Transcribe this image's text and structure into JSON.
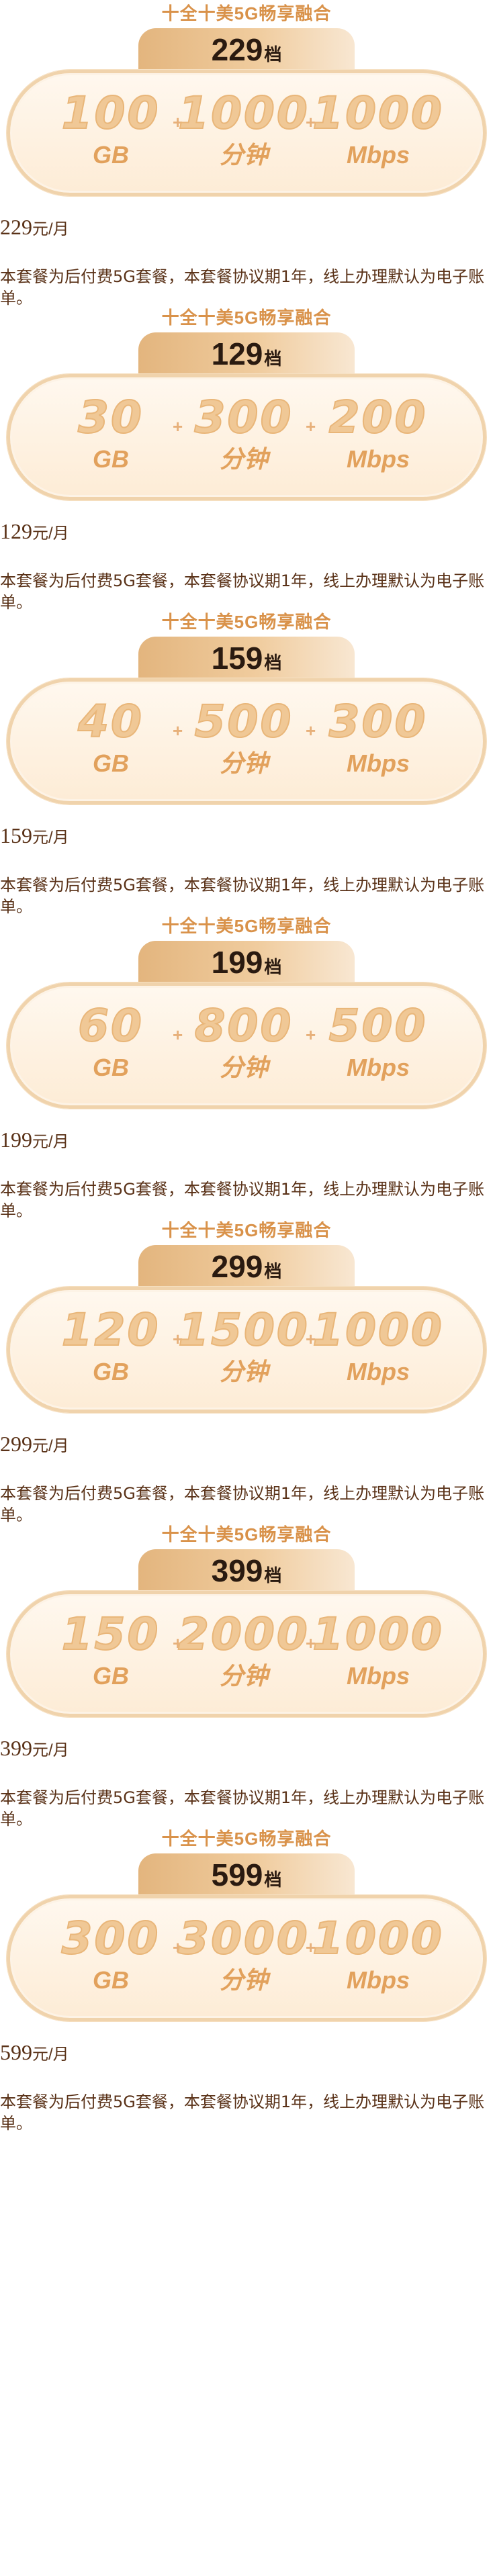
{
  "plans": [
    {
      "title": "十全十美5G畅享融合",
      "tier_value": "229",
      "tier_unit": "档",
      "data_value": "100",
      "data_unit": "GB",
      "voice_value": "1000",
      "voice_unit": "分钟",
      "broadband_value": "1000",
      "broadband_unit": "Mbps",
      "price_value": "229",
      "price_unit": "元/月",
      "description": "本套餐为后付费5G套餐，本套餐协议期1年，线上办理默认为电子账单。"
    },
    {
      "title": "十全十美5G畅享融合",
      "tier_value": "129",
      "tier_unit": "档",
      "data_value": "30",
      "data_unit": "GB",
      "voice_value": "300",
      "voice_unit": "分钟",
      "broadband_value": "200",
      "broadband_unit": "Mbps",
      "price_value": "129",
      "price_unit": "元/月",
      "description": "本套餐为后付费5G套餐，本套餐协议期1年，线上办理默认为电子账单。"
    },
    {
      "title": "十全十美5G畅享融合",
      "tier_value": "159",
      "tier_unit": "档",
      "data_value": "40",
      "data_unit": "GB",
      "voice_value": "500",
      "voice_unit": "分钟",
      "broadband_value": "300",
      "broadband_unit": "Mbps",
      "price_value": "159",
      "price_unit": "元/月",
      "description": "本套餐为后付费5G套餐，本套餐协议期1年，线上办理默认为电子账单。"
    },
    {
      "title": "十全十美5G畅享融合",
      "tier_value": "199",
      "tier_unit": "档",
      "data_value": "60",
      "data_unit": "GB",
      "voice_value": "800",
      "voice_unit": "分钟",
      "broadband_value": "500",
      "broadband_unit": "Mbps",
      "price_value": "199",
      "price_unit": "元/月",
      "description": "本套餐为后付费5G套餐，本套餐协议期1年，线上办理默认为电子账单。"
    },
    {
      "title": "十全十美5G畅享融合",
      "tier_value": "299",
      "tier_unit": "档",
      "data_value": "120",
      "data_unit": "GB",
      "voice_value": "1500",
      "voice_unit": "分钟",
      "broadband_value": "1000",
      "broadband_unit": "Mbps",
      "price_value": "299",
      "price_unit": "元/月",
      "description": "本套餐为后付费5G套餐，本套餐协议期1年，线上办理默认为电子账单。"
    },
    {
      "title": "十全十美5G畅享融合",
      "tier_value": "399",
      "tier_unit": "档",
      "data_value": "150",
      "data_unit": "GB",
      "voice_value": "2000",
      "voice_unit": "分钟",
      "broadband_value": "1000",
      "broadband_unit": "Mbps",
      "price_value": "399",
      "price_unit": "元/月",
      "description": "本套餐为后付费5G套餐，本套餐协议期1年，线上办理默认为电子账单。"
    },
    {
      "title": "十全十美5G畅享融合",
      "tier_value": "599",
      "tier_unit": "档",
      "data_value": "300",
      "data_unit": "GB",
      "voice_value": "3000",
      "voice_unit": "分钟",
      "broadband_value": "1000",
      "broadband_unit": "Mbps",
      "price_value": "599",
      "price_unit": "元/月",
      "description": "本套餐为后付费5G套餐，本套餐协议期1年，线上办理默认为电子账单。"
    }
  ],
  "plus_symbol": "+",
  "colors": {
    "accent": "#d9924a",
    "tab_gradient_start": "#e3b57e",
    "tab_gradient_end": "#f8e7d2",
    "capsule_fill": "#fdecd6",
    "capsule_border": "#f0d3ac",
    "metric_value": "#f0c896",
    "metric_unit": "#e2a15c",
    "body_text": "#5a3218"
  }
}
